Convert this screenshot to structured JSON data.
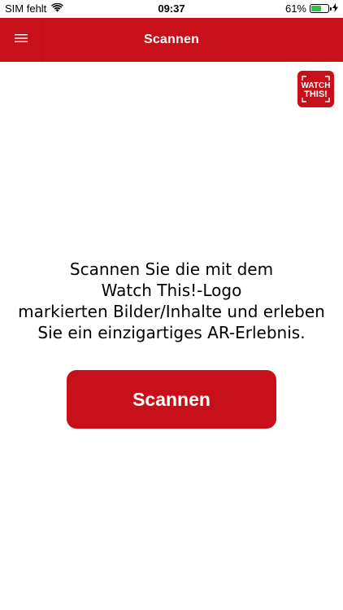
{
  "status_bar": {
    "carrier": "SIM fehlt",
    "time": "09:37",
    "battery_percent": "61%",
    "battery_level": 0.61
  },
  "nav": {
    "title": "Scannen",
    "menu_icon": "hamburger-menu-icon"
  },
  "logo": {
    "text_line1": "WATCH",
    "text_line2": "THIS!"
  },
  "instruction": {
    "lines": [
      "Scannen Sie die mit dem",
      "Watch This!-Logo",
      "markierten Bilder/Inhalte und erleben",
      "Sie ein einzigartiges AR-Erlebnis."
    ]
  },
  "scan_button": {
    "label": "Scannen"
  },
  "colors": {
    "brand_red": "#c8101a",
    "battery_green": "#31c24b"
  }
}
